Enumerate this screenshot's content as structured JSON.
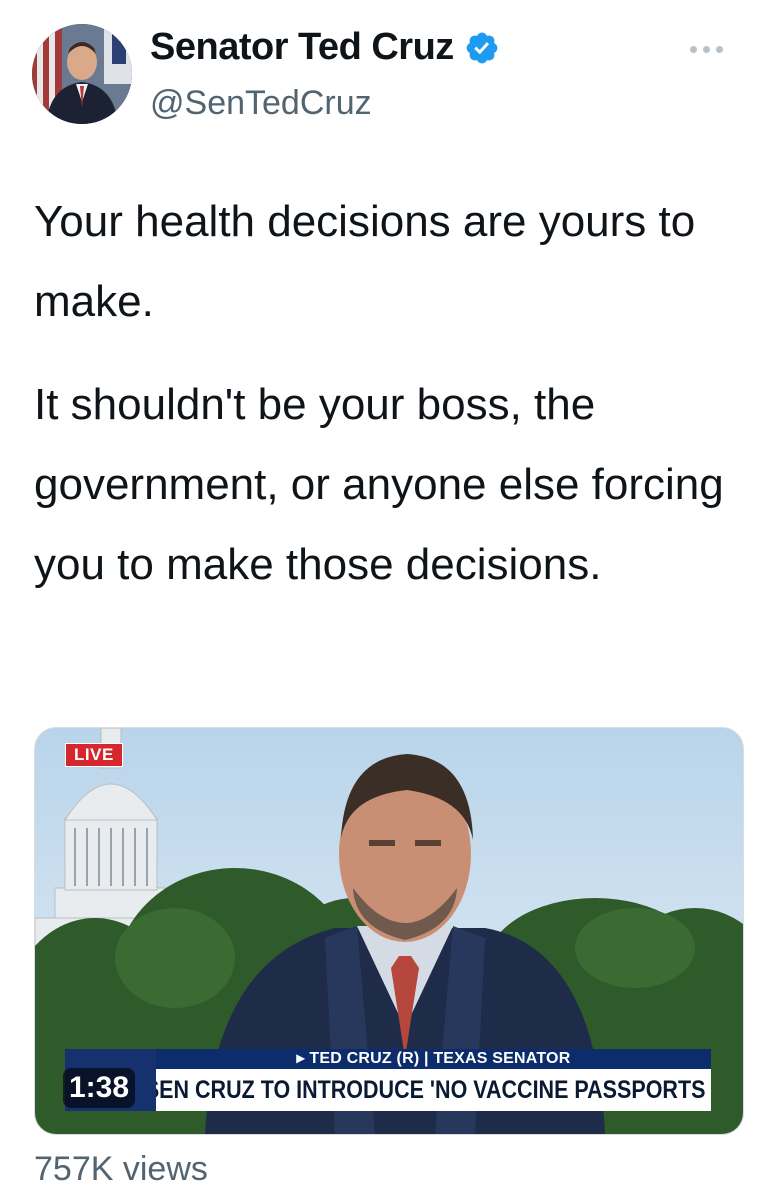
{
  "author": {
    "name": "Senator Ted Cruz",
    "handle": "@SenTedCruz",
    "verified_icon": "verified-badge-icon",
    "accent_color": "#1d9bf0"
  },
  "tweet": {
    "paragraph_1": "Your health decisions are yours to make.",
    "paragraph_2": "It shouldn't be your boss, the government, or anyone else forcing you to make those decisions."
  },
  "media": {
    "live_label": "LIVE",
    "lower_third_top": "▸ TED CRUZ (R) | TEXAS SENATOR",
    "lower_third_main": "SEN CRUZ TO INTRODUCE 'NO VACCINE PASSPORTS ACT'",
    "duration": "1:38"
  },
  "stats": {
    "views": "757K views"
  }
}
